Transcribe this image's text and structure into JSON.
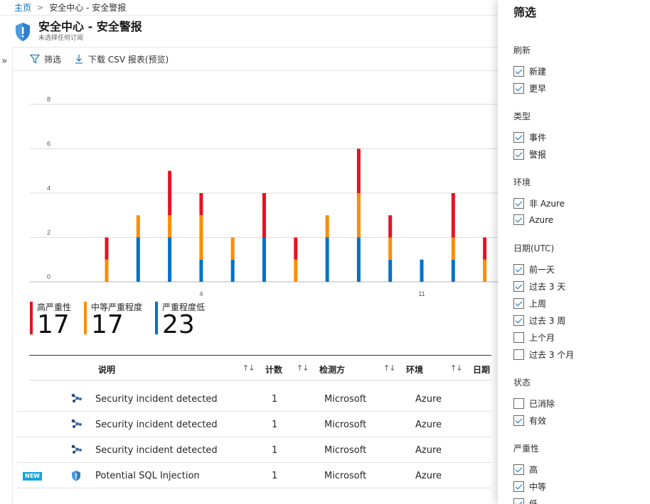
{
  "breadcrumb": {
    "home": "主页",
    "current": "安全中心 - 安全警报"
  },
  "header": {
    "title": "安全中心 - 安全警报",
    "subtitle": "未选择任何订阅"
  },
  "toolbar": {
    "filter_label": "筛选",
    "download_label": "下载 CSV 报表(预览)"
  },
  "colors": {
    "high": "#e81123",
    "medium": "#ff8c00",
    "low": "#0072c6",
    "accent": "#0066b8"
  },
  "chart_data": {
    "type": "bar",
    "stacked": true,
    "ylim": [
      0,
      8
    ],
    "y_ticks": [
      "8",
      "6",
      "4",
      "2",
      "0"
    ],
    "x_tick_labels": [
      {
        "label": "4",
        "day": 4
      },
      {
        "label": "11",
        "day": 11
      }
    ],
    "days": [
      1,
      2,
      3,
      4,
      5,
      6,
      7,
      8,
      9,
      10,
      11,
      12,
      13,
      14
    ],
    "series": [
      {
        "name": "严重程度低",
        "color": "#0072c6",
        "values": [
          0,
          2,
          2,
          1,
          1,
          2,
          0,
          2,
          2,
          1,
          1,
          1,
          0,
          0
        ]
      },
      {
        "name": "中等严重程度",
        "color": "#ff8c00",
        "values": [
          1,
          1,
          1,
          2,
          1,
          0,
          1,
          1,
          2,
          1,
          0,
          1,
          1,
          0
        ]
      },
      {
        "name": "高严重性",
        "color": "#e81123",
        "values": [
          1,
          0,
          2,
          1,
          0,
          2,
          1,
          0,
          2,
          1,
          0,
          2,
          1,
          0
        ]
      }
    ]
  },
  "totals": [
    {
      "label": "高严重性",
      "value": "17",
      "color": "#e81123"
    },
    {
      "label": "中等严重程度",
      "value": "17",
      "color": "#ff8c00"
    },
    {
      "label": "严重程度低",
      "value": "23",
      "color": "#0072c6"
    }
  ],
  "table": {
    "headers": {
      "description": "说明",
      "count": "计数",
      "detected_by": "检测方",
      "environment": "环境",
      "date": "日期"
    },
    "rows": [
      {
        "badge": "",
        "icon": "incident-icon",
        "description": "Security incident detected",
        "count": "1",
        "detected_by": "Microsoft",
        "environment": "Azure"
      },
      {
        "badge": "",
        "icon": "incident-icon",
        "description": "Security incident detected",
        "count": "1",
        "detected_by": "Microsoft",
        "environment": "Azure"
      },
      {
        "badge": "",
        "icon": "incident-icon",
        "description": "Security incident detected",
        "count": "1",
        "detected_by": "Microsoft",
        "environment": "Azure"
      },
      {
        "badge": "NEW",
        "icon": "shield-alert-icon",
        "description": "Potential SQL Injection",
        "count": "1",
        "detected_by": "Microsoft",
        "environment": "Azure"
      }
    ]
  },
  "filter": {
    "title": "筛选",
    "sections": [
      {
        "label": "刷新",
        "items": [
          {
            "label": "新建",
            "checked": true
          },
          {
            "label": "更早",
            "checked": true
          }
        ]
      },
      {
        "label": "类型",
        "items": [
          {
            "label": "事件",
            "checked": true
          },
          {
            "label": "警报",
            "checked": true
          }
        ]
      },
      {
        "label": "环境",
        "items": [
          {
            "label": "非 Azure",
            "checked": true
          },
          {
            "label": "Azure",
            "checked": true
          }
        ]
      },
      {
        "label": "日期(UTC)",
        "items": [
          {
            "label": "前一天",
            "checked": true
          },
          {
            "label": "过去 3 天",
            "checked": true
          },
          {
            "label": "上周",
            "checked": true
          },
          {
            "label": "过去 3 周",
            "checked": true
          },
          {
            "label": "上个月",
            "checked": false
          },
          {
            "label": "过去 3 个月",
            "checked": false
          }
        ]
      },
      {
        "label": "状态",
        "items": [
          {
            "label": "已消除",
            "checked": false
          },
          {
            "label": "有效",
            "checked": true
          }
        ]
      },
      {
        "label": "严重性",
        "items": [
          {
            "label": "高",
            "checked": true
          },
          {
            "label": "中等",
            "checked": true
          },
          {
            "label": "低",
            "checked": true
          }
        ]
      }
    ]
  }
}
